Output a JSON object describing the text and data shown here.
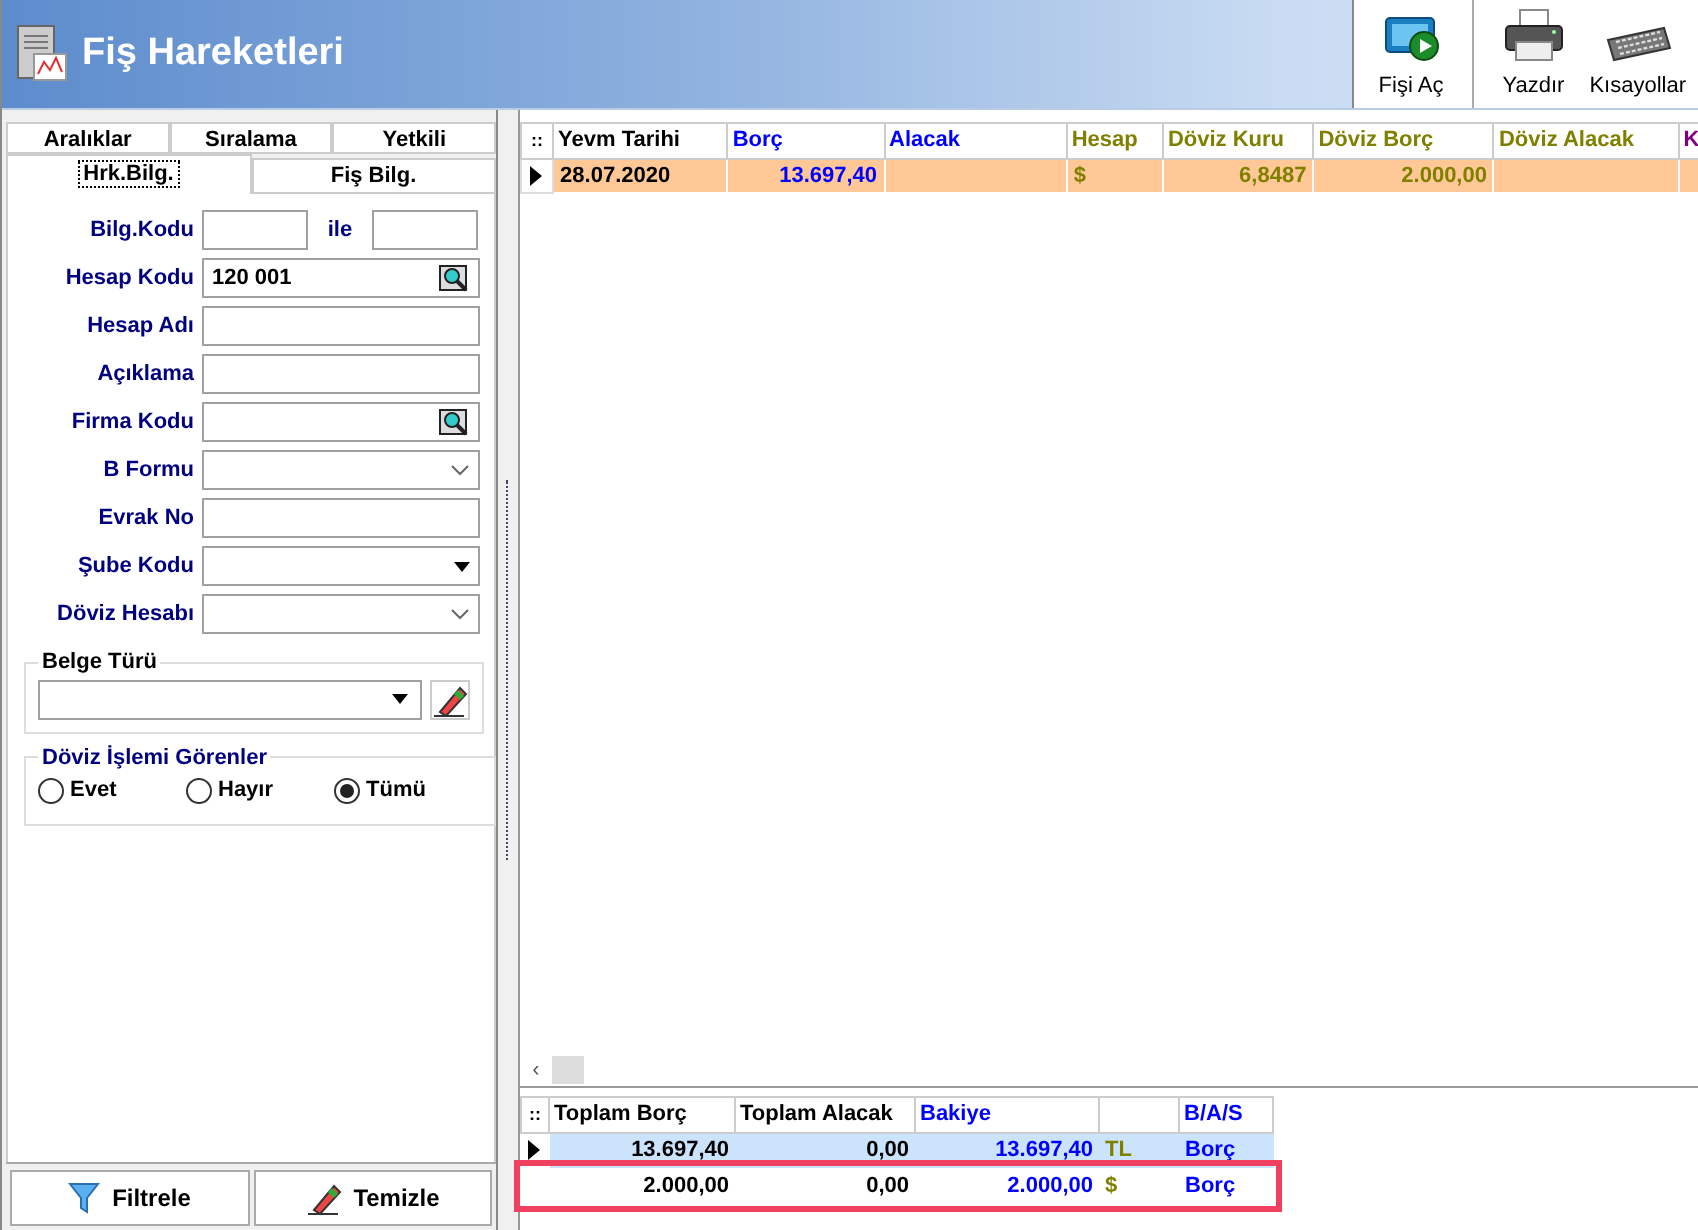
{
  "window": {
    "title": "Fiş Hareketleri"
  },
  "toolbar": [
    {
      "label": "Fişi Aç",
      "kind": "open"
    },
    {
      "label": "Yazdır",
      "kind": "print"
    },
    {
      "label": "Kısayollar",
      "kind": "keyboard"
    }
  ],
  "tabs_back": [
    {
      "label": "Aralıklar",
      "selected": false
    },
    {
      "label": "Sıralama",
      "selected": false
    },
    {
      "label": "Yetkili",
      "selected": false
    }
  ],
  "tabs_front": [
    {
      "label": "Hrk.Bilg.",
      "selected": true
    },
    {
      "label": "Fiş Bilg.",
      "selected": false
    }
  ],
  "range_field": {
    "label": "Bilg.Kodu",
    "separator": "ile"
  },
  "fields": [
    {
      "label": "Hesap Kodu",
      "kind": "lookup",
      "value": "120 001"
    },
    {
      "label": "Hesap Adı",
      "kind": "text"
    },
    {
      "label": "Açıklama",
      "kind": "text"
    },
    {
      "label": "Firma Kodu",
      "kind": "lookup"
    },
    {
      "label": "B Formu",
      "kind": "select"
    },
    {
      "label": "Evrak No",
      "kind": "text"
    },
    {
      "label": "Şube Kodu",
      "kind": "dropdown"
    },
    {
      "label": "Döviz Hesabı",
      "kind": "select"
    }
  ],
  "belge_turu": {
    "title": "Belge Türü"
  },
  "doviz_islemi": {
    "title": "Döviz İşlemi Görenler",
    "options": [
      {
        "label": "Evet",
        "selected": false
      },
      {
        "label": "Hayır",
        "selected": false
      },
      {
        "label": "Tümü",
        "selected": true
      }
    ]
  },
  "buttons": [
    {
      "label": "Filtrele",
      "kind": "filter"
    },
    {
      "label": "Temizle",
      "kind": "clear"
    }
  ],
  "table": {
    "corner": "::",
    "columns": [
      {
        "label": "Yevm Tarihi",
        "color": "#000000"
      },
      {
        "label": "Borç",
        "color": "#0000ff"
      },
      {
        "label": "Alacak",
        "color": "#0000ff"
      },
      {
        "label": "Hesap",
        "color": "#808000"
      },
      {
        "label": "Döviz Kuru",
        "color": "#808000"
      },
      {
        "label": "Döviz Borç",
        "color": "#808000"
      },
      {
        "label": "Döviz Alacak",
        "color": "#808000"
      },
      {
        "label": "K",
        "color": "#800080"
      }
    ],
    "rows": [
      {
        "selected": true,
        "cells": [
          "28.07.2020",
          "13.697,40",
          "",
          "$",
          "6,8487",
          "2.000,00",
          "",
          ""
        ]
      }
    ],
    "scroll_left": "‹"
  },
  "summary": {
    "corner": "::",
    "columns": [
      {
        "label": "Toplam Borç",
        "color": "#000000"
      },
      {
        "label": "Toplam Alacak",
        "color": "#000000"
      },
      {
        "label": "Bakiye",
        "color": "#0000ff"
      },
      {
        "color": "#808000"
      },
      {
        "label": "B/A/S",
        "color": "#0000ff"
      }
    ],
    "rows": [
      {
        "selected": true,
        "highlighted": false,
        "cells": [
          "13.697,40",
          "0,00",
          "13.697,40",
          "TL",
          "Borç"
        ]
      },
      {
        "selected": false,
        "highlighted": true,
        "cells": [
          "2.000,00",
          "0,00",
          "2.000,00",
          "$",
          "Borç"
        ]
      }
    ]
  }
}
